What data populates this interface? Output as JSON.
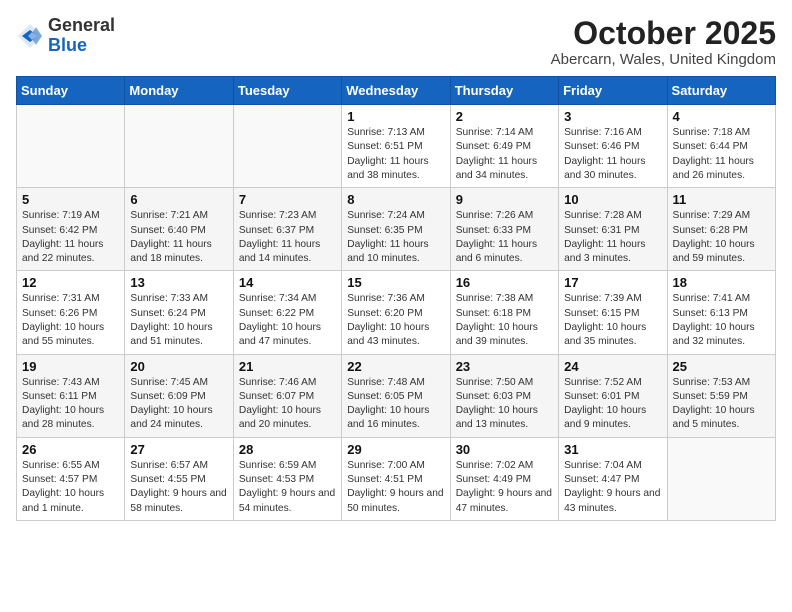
{
  "header": {
    "logo_general": "General",
    "logo_blue": "Blue",
    "month": "October 2025",
    "location": "Abercarn, Wales, United Kingdom"
  },
  "weekdays": [
    "Sunday",
    "Monday",
    "Tuesday",
    "Wednesday",
    "Thursday",
    "Friday",
    "Saturday"
  ],
  "weeks": [
    [
      {
        "day": "",
        "info": ""
      },
      {
        "day": "",
        "info": ""
      },
      {
        "day": "",
        "info": ""
      },
      {
        "day": "1",
        "info": "Sunrise: 7:13 AM\nSunset: 6:51 PM\nDaylight: 11 hours\nand 38 minutes."
      },
      {
        "day": "2",
        "info": "Sunrise: 7:14 AM\nSunset: 6:49 PM\nDaylight: 11 hours\nand 34 minutes."
      },
      {
        "day": "3",
        "info": "Sunrise: 7:16 AM\nSunset: 6:46 PM\nDaylight: 11 hours\nand 30 minutes."
      },
      {
        "day": "4",
        "info": "Sunrise: 7:18 AM\nSunset: 6:44 PM\nDaylight: 11 hours\nand 26 minutes."
      }
    ],
    [
      {
        "day": "5",
        "info": "Sunrise: 7:19 AM\nSunset: 6:42 PM\nDaylight: 11 hours\nand 22 minutes."
      },
      {
        "day": "6",
        "info": "Sunrise: 7:21 AM\nSunset: 6:40 PM\nDaylight: 11 hours\nand 18 minutes."
      },
      {
        "day": "7",
        "info": "Sunrise: 7:23 AM\nSunset: 6:37 PM\nDaylight: 11 hours\nand 14 minutes."
      },
      {
        "day": "8",
        "info": "Sunrise: 7:24 AM\nSunset: 6:35 PM\nDaylight: 11 hours\nand 10 minutes."
      },
      {
        "day": "9",
        "info": "Sunrise: 7:26 AM\nSunset: 6:33 PM\nDaylight: 11 hours\nand 6 minutes."
      },
      {
        "day": "10",
        "info": "Sunrise: 7:28 AM\nSunset: 6:31 PM\nDaylight: 11 hours\nand 3 minutes."
      },
      {
        "day": "11",
        "info": "Sunrise: 7:29 AM\nSunset: 6:28 PM\nDaylight: 10 hours\nand 59 minutes."
      }
    ],
    [
      {
        "day": "12",
        "info": "Sunrise: 7:31 AM\nSunset: 6:26 PM\nDaylight: 10 hours\nand 55 minutes."
      },
      {
        "day": "13",
        "info": "Sunrise: 7:33 AM\nSunset: 6:24 PM\nDaylight: 10 hours\nand 51 minutes."
      },
      {
        "day": "14",
        "info": "Sunrise: 7:34 AM\nSunset: 6:22 PM\nDaylight: 10 hours\nand 47 minutes."
      },
      {
        "day": "15",
        "info": "Sunrise: 7:36 AM\nSunset: 6:20 PM\nDaylight: 10 hours\nand 43 minutes."
      },
      {
        "day": "16",
        "info": "Sunrise: 7:38 AM\nSunset: 6:18 PM\nDaylight: 10 hours\nand 39 minutes."
      },
      {
        "day": "17",
        "info": "Sunrise: 7:39 AM\nSunset: 6:15 PM\nDaylight: 10 hours\nand 35 minutes."
      },
      {
        "day": "18",
        "info": "Sunrise: 7:41 AM\nSunset: 6:13 PM\nDaylight: 10 hours\nand 32 minutes."
      }
    ],
    [
      {
        "day": "19",
        "info": "Sunrise: 7:43 AM\nSunset: 6:11 PM\nDaylight: 10 hours\nand 28 minutes."
      },
      {
        "day": "20",
        "info": "Sunrise: 7:45 AM\nSunset: 6:09 PM\nDaylight: 10 hours\nand 24 minutes."
      },
      {
        "day": "21",
        "info": "Sunrise: 7:46 AM\nSunset: 6:07 PM\nDaylight: 10 hours\nand 20 minutes."
      },
      {
        "day": "22",
        "info": "Sunrise: 7:48 AM\nSunset: 6:05 PM\nDaylight: 10 hours\nand 16 minutes."
      },
      {
        "day": "23",
        "info": "Sunrise: 7:50 AM\nSunset: 6:03 PM\nDaylight: 10 hours\nand 13 minutes."
      },
      {
        "day": "24",
        "info": "Sunrise: 7:52 AM\nSunset: 6:01 PM\nDaylight: 10 hours\nand 9 minutes."
      },
      {
        "day": "25",
        "info": "Sunrise: 7:53 AM\nSunset: 5:59 PM\nDaylight: 10 hours\nand 5 minutes."
      }
    ],
    [
      {
        "day": "26",
        "info": "Sunrise: 6:55 AM\nSunset: 4:57 PM\nDaylight: 10 hours\nand 1 minute."
      },
      {
        "day": "27",
        "info": "Sunrise: 6:57 AM\nSunset: 4:55 PM\nDaylight: 9 hours\nand 58 minutes."
      },
      {
        "day": "28",
        "info": "Sunrise: 6:59 AM\nSunset: 4:53 PM\nDaylight: 9 hours\nand 54 minutes."
      },
      {
        "day": "29",
        "info": "Sunrise: 7:00 AM\nSunset: 4:51 PM\nDaylight: 9 hours\nand 50 minutes."
      },
      {
        "day": "30",
        "info": "Sunrise: 7:02 AM\nSunset: 4:49 PM\nDaylight: 9 hours\nand 47 minutes."
      },
      {
        "day": "31",
        "info": "Sunrise: 7:04 AM\nSunset: 4:47 PM\nDaylight: 9 hours\nand 43 minutes."
      },
      {
        "day": "",
        "info": ""
      }
    ]
  ]
}
